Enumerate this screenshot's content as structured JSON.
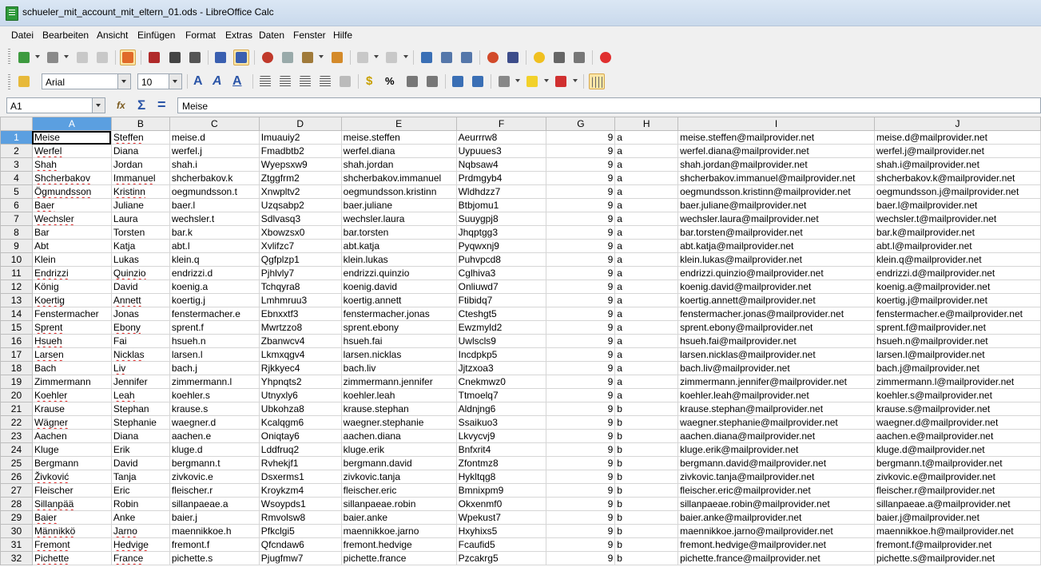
{
  "window": {
    "title": "schueler_mit_account_mit_eltern_01.ods - LibreOffice Calc"
  },
  "menu": [
    "Datei",
    "Bearbeiten",
    "Ansicht",
    "Einfügen",
    "Format",
    "Extras",
    "Daten",
    "Fenster",
    "Hilfe"
  ],
  "toolbar2": {
    "font_name": "Arial",
    "font_size": "10"
  },
  "formula_bar": {
    "cell_ref": "A1",
    "content": "Meise"
  },
  "sheet": {
    "columns": [
      "A",
      "B",
      "C",
      "D",
      "E",
      "F",
      "G",
      "H",
      "I",
      "J"
    ],
    "rows": [
      [
        "Meise",
        "Steffen",
        "meise.d",
        "Imuauiy2",
        "meise.steffen",
        "Aeurrrw8",
        "9",
        "a",
        "meise.steffen@mailprovider.net",
        "meise.d@mailprovider.net"
      ],
      [
        "Werfel",
        "Diana",
        "werfel.j",
        "Fmadbtb2",
        "werfel.diana",
        "Uypuues3",
        "9",
        "a",
        "werfel.diana@mailprovider.net",
        "werfel.j@mailprovider.net"
      ],
      [
        "Shah",
        "Jordan",
        "shah.i",
        "Wyepsxw9",
        "shah.jordan",
        "Nqbsaw4",
        "9",
        "a",
        "shah.jordan@mailprovider.net",
        "shah.i@mailprovider.net"
      ],
      [
        "Shcherbakov",
        "Immanuel",
        "shcherbakov.k",
        "Ztggfrm2",
        "shcherbakov.immanuel",
        "Prdmgyb4",
        "9",
        "a",
        "shcherbakov.immanuel@mailprovider.net",
        "shcherbakov.k@mailprovider.net"
      ],
      [
        "Ögmundsson",
        "Kristinn",
        "oegmundsson.t",
        "Xnwpltv2",
        "oegmundsson.kristinn",
        "Wldhdzz7",
        "9",
        "a",
        "oegmundsson.kristinn@mailprovider.net",
        "oegmundsson.j@mailprovider.net"
      ],
      [
        "Baer",
        "Juliane",
        "baer.l",
        "Uzqsabp2",
        "baer.juliane",
        "Btbjomu1",
        "9",
        "a",
        "baer.juliane@mailprovider.net",
        "baer.l@mailprovider.net"
      ],
      [
        "Wechsler",
        "Laura",
        "wechsler.t",
        "Sdlvasq3",
        "wechsler.laura",
        "Suuygpj8",
        "9",
        "a",
        "wechsler.laura@mailprovider.net",
        "wechsler.t@mailprovider.net"
      ],
      [
        "Bar",
        "Torsten",
        "bar.k",
        "Xbowzsx0",
        "bar.torsten",
        "Jhqptgg3",
        "9",
        "a",
        "bar.torsten@mailprovider.net",
        "bar.k@mailprovider.net"
      ],
      [
        "Abt",
        "Katja",
        "abt.l",
        "Xvlifzc7",
        "abt.katja",
        "Pyqwxnj9",
        "9",
        "a",
        "abt.katja@mailprovider.net",
        "abt.l@mailprovider.net"
      ],
      [
        "Klein",
        "Lukas",
        "klein.q",
        "Qgfplzp1",
        "klein.lukas",
        "Puhvpcd8",
        "9",
        "a",
        "klein.lukas@mailprovider.net",
        "klein.q@mailprovider.net"
      ],
      [
        "Endrizzi",
        "Quinzio",
        "endrizzi.d",
        "Pjhlvly7",
        "endrizzi.quinzio",
        "Cglhiva3",
        "9",
        "a",
        "endrizzi.quinzio@mailprovider.net",
        "endrizzi.d@mailprovider.net"
      ],
      [
        "König",
        "David",
        "koenig.a",
        "Tchqyra8",
        "koenig.david",
        "Onliuwd7",
        "9",
        "a",
        "koenig.david@mailprovider.net",
        "koenig.a@mailprovider.net"
      ],
      [
        "Koertig",
        "Annett",
        "koertig.j",
        "Lmhmruu3",
        "koertig.annett",
        "Ftibidq7",
        "9",
        "a",
        "koertig.annett@mailprovider.net",
        "koertig.j@mailprovider.net"
      ],
      [
        "Fenstermacher",
        "Jonas",
        "fenstermacher.e",
        "Ebnxxtf3",
        "fenstermacher.jonas",
        "Cteshgt5",
        "9",
        "a",
        "fenstermacher.jonas@mailprovider.net",
        "fenstermacher.e@mailprovider.net"
      ],
      [
        "Sprent",
        "Ebony",
        "sprent.f",
        "Mwrtzzo8",
        "sprent.ebony",
        "Ewzmyld2",
        "9",
        "a",
        "sprent.ebony@mailprovider.net",
        "sprent.f@mailprovider.net"
      ],
      [
        "Hsueh",
        "Fai",
        "hsueh.n",
        "Zbanwcv4",
        "hsueh.fai",
        "Uwlscls9",
        "9",
        "a",
        "hsueh.fai@mailprovider.net",
        "hsueh.n@mailprovider.net"
      ],
      [
        "Larsen",
        "Nicklas",
        "larsen.l",
        "Lkmxqgv4",
        "larsen.nicklas",
        "Incdpkp5",
        "9",
        "a",
        "larsen.nicklas@mailprovider.net",
        "larsen.l@mailprovider.net"
      ],
      [
        "Bach",
        "Liv",
        "bach.j",
        "Rjkkyec4",
        "bach.liv",
        "Jjtzxoa3",
        "9",
        "a",
        "bach.liv@mailprovider.net",
        "bach.j@mailprovider.net"
      ],
      [
        "Zimmermann",
        "Jennifer",
        "zimmermann.l",
        "Yhpnqts2",
        "zimmermann.jennifer",
        "Cnekmwz0",
        "9",
        "a",
        "zimmermann.jennifer@mailprovider.net",
        "zimmermann.l@mailprovider.net"
      ],
      [
        "Koehler",
        "Leah",
        "koehler.s",
        "Utnyxly6",
        "koehler.leah",
        "Ttmoelq7",
        "9",
        "a",
        "koehler.leah@mailprovider.net",
        "koehler.s@mailprovider.net"
      ],
      [
        "Krause",
        "Stephan",
        "krause.s",
        "Ubkohza8",
        "krause.stephan",
        "Aldnjng6",
        "9",
        "b",
        "krause.stephan@mailprovider.net",
        "krause.s@mailprovider.net"
      ],
      [
        "Wägner",
        "Stephanie",
        "waegner.d",
        "Kcalqgm6",
        "waegner.stephanie",
        "Ssaikuo3",
        "9",
        "b",
        "waegner.stephanie@mailprovider.net",
        "waegner.d@mailprovider.net"
      ],
      [
        "Aachen",
        "Diana",
        "aachen.e",
        "Oniqtay6",
        "aachen.diana",
        "Lkvycvj9",
        "9",
        "b",
        "aachen.diana@mailprovider.net",
        "aachen.e@mailprovider.net"
      ],
      [
        "Kluge",
        "Erik",
        "kluge.d",
        "Lddfruq2",
        "kluge.erik",
        "Bnfxrit4",
        "9",
        "b",
        "kluge.erik@mailprovider.net",
        "kluge.d@mailprovider.net"
      ],
      [
        "Bergmann",
        "David",
        "bergmann.t",
        "Rvhekjf1",
        "bergmann.david",
        "Zfontmz8",
        "9",
        "b",
        "bergmann.david@mailprovider.net",
        "bergmann.t@mailprovider.net"
      ],
      [
        "Živković",
        "Tanja",
        "zivkovic.e",
        "Dsxerms1",
        "zivkovic.tanja",
        "Hykltqg8",
        "9",
        "b",
        "zivkovic.tanja@mailprovider.net",
        "zivkovic.e@mailprovider.net"
      ],
      [
        "Fleischer",
        "Eric",
        "fleischer.r",
        "Kroykzm4",
        "fleischer.eric",
        "Bmnixpm9",
        "9",
        "b",
        "fleischer.eric@mailprovider.net",
        "fleischer.r@mailprovider.net"
      ],
      [
        "Sillanpää",
        "Robin",
        "sillanpaeae.a",
        "Wsoypds1",
        "sillanpaeae.robin",
        "Okxenmf0",
        "9",
        "b",
        "sillanpaeae.robin@mailprovider.net",
        "sillanpaeae.a@mailprovider.net"
      ],
      [
        "Baier",
        "Anke",
        "baier.j",
        "Rmvolsw8",
        "baier.anke",
        "Wpekust7",
        "9",
        "b",
        "baier.anke@mailprovider.net",
        "baier.j@mailprovider.net"
      ],
      [
        "Männikkö",
        "Jarno",
        "maennikkoe.h",
        "Pfkclgi5",
        "maennikkoe.jarno",
        "Hxyhixs5",
        "9",
        "b",
        "maennikkoe.jarno@mailprovider.net",
        "maennikkoe.h@mailprovider.net"
      ],
      [
        "Fremont",
        "Hedvige",
        "fremont.f",
        "Qfcndaw6",
        "fremont.hedvige",
        "Fcaufid5",
        "9",
        "b",
        "fremont.hedvige@mailprovider.net",
        "fremont.f@mailprovider.net"
      ],
      [
        "Pichette",
        "France",
        "pichette.s",
        "Pjugfmw7",
        "pichette.france",
        "Pzcakrg5",
        "9",
        "b",
        "pichette.france@mailprovider.net",
        "pichette.s@mailprovider.net"
      ]
    ],
    "spellcheck": {
      "0": [
        0,
        1
      ],
      "1": [
        0
      ],
      "2": [
        0
      ],
      "3": [
        0,
        1
      ],
      "4": [
        0,
        1
      ],
      "5": [
        0
      ],
      "6": [
        0
      ],
      "7": [],
      "8": [],
      "9": [],
      "10": [
        0,
        1
      ],
      "11": [],
      "12": [
        0,
        1
      ],
      "13": [],
      "14": [
        0,
        1
      ],
      "15": [
        0
      ],
      "16": [
        0,
        1
      ],
      "17": [
        1
      ],
      "18": [],
      "19": [
        0,
        1
      ],
      "20": [],
      "21": [
        0
      ],
      "22": [],
      "23": [],
      "24": [],
      "25": [
        0
      ],
      "26": [],
      "27": [
        0
      ],
      "28": [
        0
      ],
      "29": [
        0,
        1
      ],
      "30": [
        0,
        1
      ],
      "31": [
        0,
        1
      ]
    }
  }
}
